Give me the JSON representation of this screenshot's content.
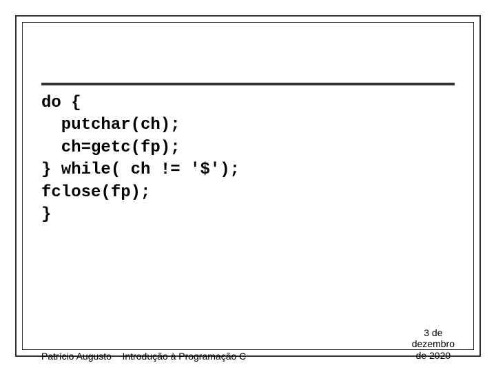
{
  "code": {
    "line1": "do {",
    "line2": "  putchar(ch);",
    "line3": "  ch=getc(fp);",
    "line4": "} while( ch != '$');",
    "line5": "fclose(fp);",
    "line6": "}"
  },
  "footer": {
    "author": "Patrício Augusto",
    "title": "Introdução à Programação C",
    "date_line1": "3 de",
    "date_line2": "dezembro",
    "date_line3": "de 2020"
  }
}
